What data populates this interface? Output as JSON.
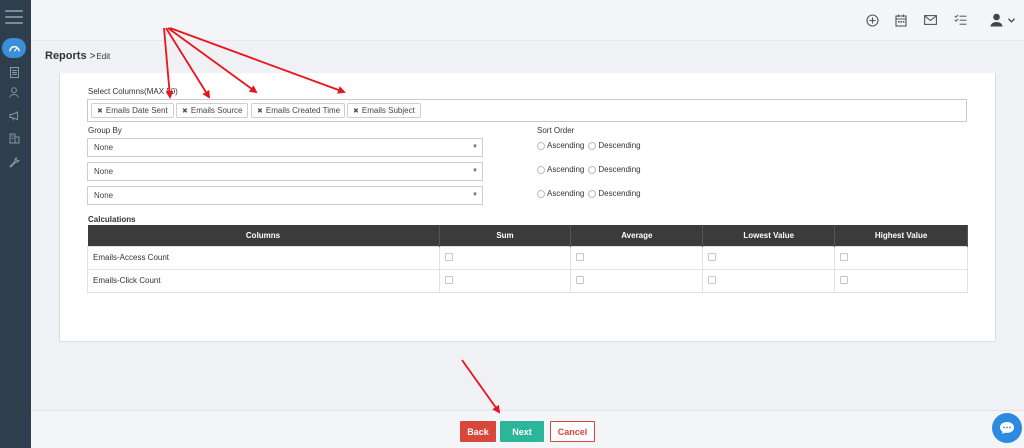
{
  "breadcrumb": {
    "main": "Reports",
    "separator": ">",
    "sub": "Edit"
  },
  "form": {
    "select_columns_label": "Select Columns(MAX 50)",
    "selected_columns": [
      "Emails Date Sent",
      "Emails Source",
      "Emails Created Time",
      "Emails Subject"
    ],
    "tag_remove_glyph": "✖",
    "group_by_label": "Group By",
    "sort_order_label": "Sort Order",
    "group_by_values": [
      "None",
      "None",
      "None"
    ],
    "sort_options": [
      "Ascending",
      "Descending"
    ],
    "dropdown_caret": "▼"
  },
  "calculations": {
    "label": "Calculations",
    "headers": [
      "Columns",
      "Sum",
      "Average",
      "Lowest Value",
      "Highest Value"
    ],
    "rows": [
      "Emails-Access Count",
      "Emails-Click Count"
    ]
  },
  "footer": {
    "back": "Back",
    "next": "Next",
    "cancel": "Cancel"
  },
  "icons": {
    "sidebar": [
      "menu-icon",
      "dashboard-icon",
      "document-icon",
      "user-icon",
      "megaphone-icon",
      "building-icon",
      "wrench-icon"
    ],
    "topbar": [
      "add-circle-icon",
      "calendar-icon",
      "mail-icon",
      "tasks-icon",
      "user-icon",
      "chevron-down-icon"
    ],
    "chat": "chat-bubble-icon"
  },
  "colors": {
    "sidebar": "#2f3e4d",
    "accent": "#3b8fd8",
    "back": "#d9473b",
    "next": "#2bb69a",
    "table_header": "#3b3b3b",
    "annotation_arrow": "#e8161c"
  }
}
